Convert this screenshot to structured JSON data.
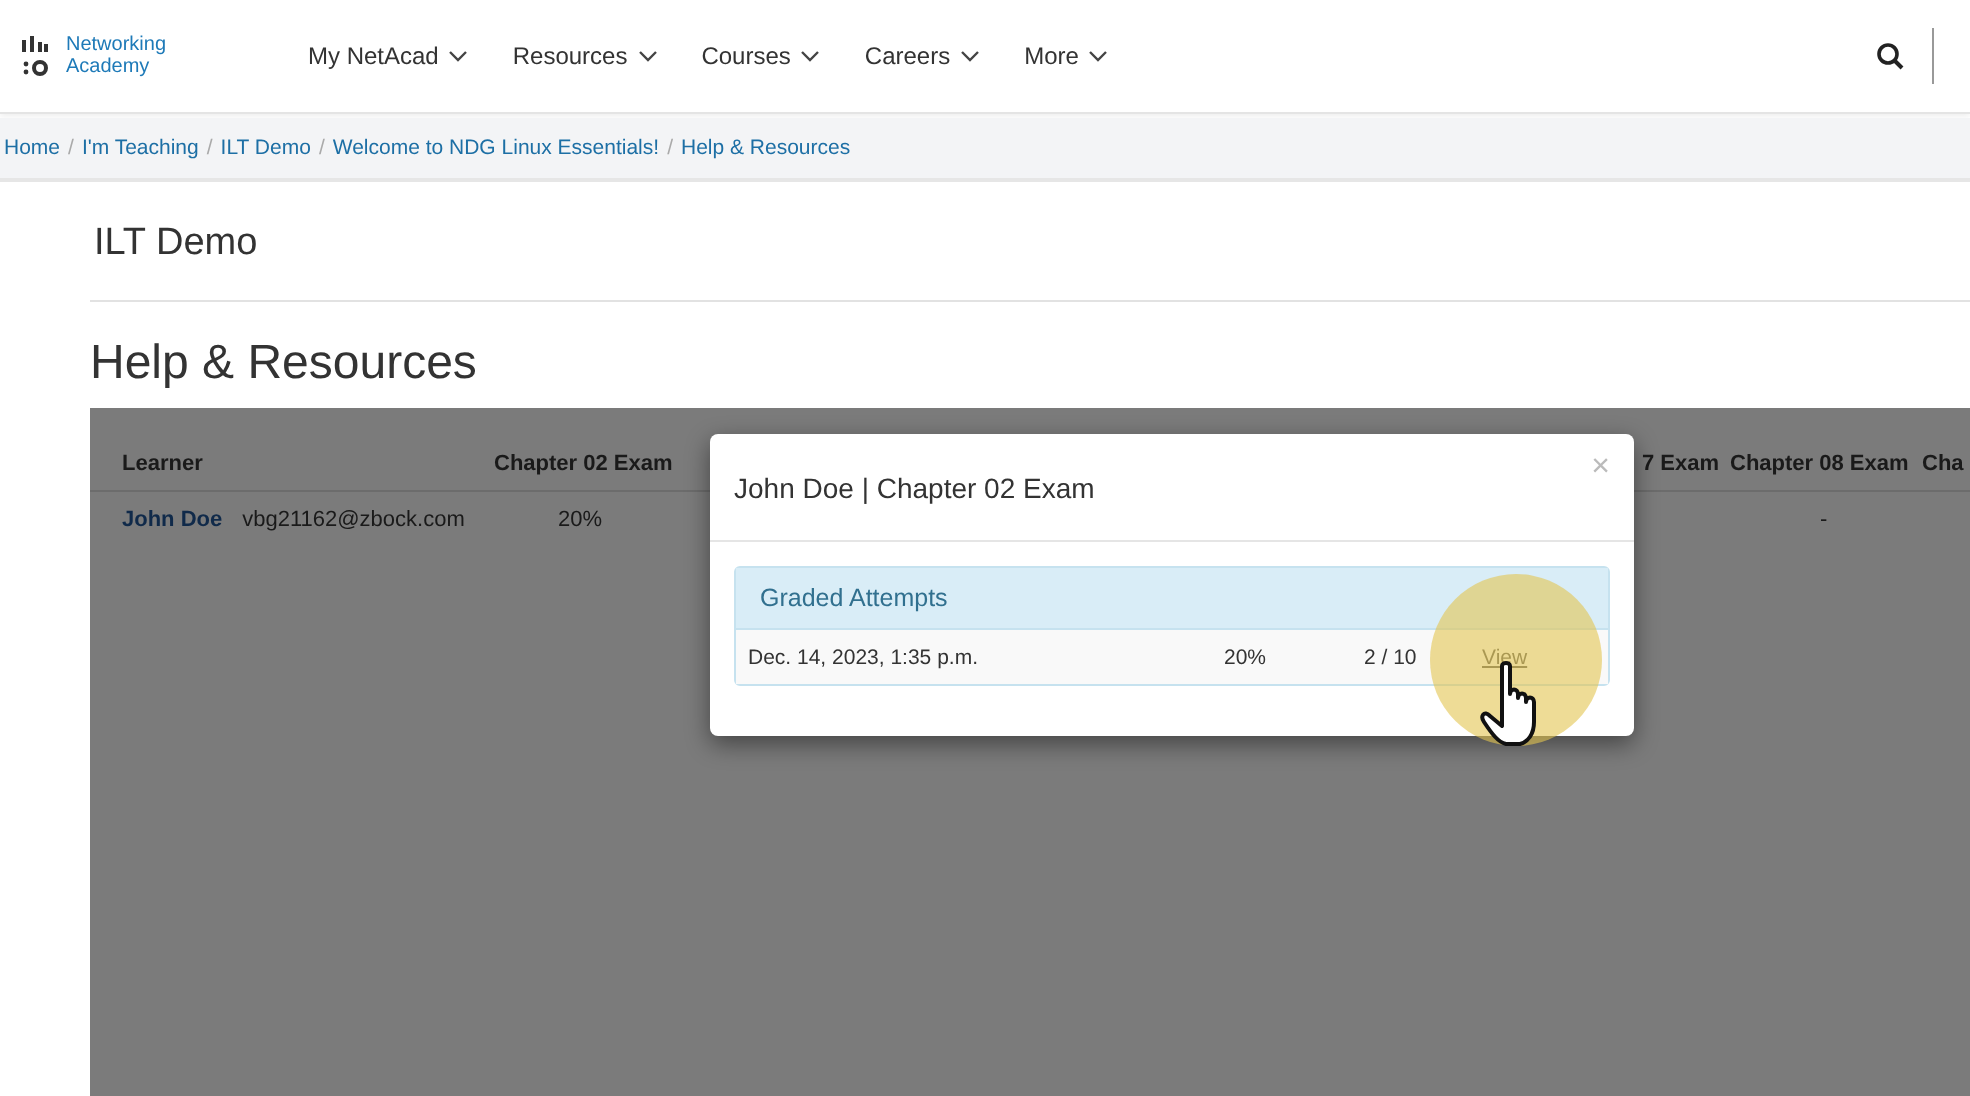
{
  "header": {
    "logo_text": [
      "Networking",
      "Academy"
    ],
    "menu": [
      {
        "label": "My NetAcad"
      },
      {
        "label": "Resources"
      },
      {
        "label": "Courses"
      },
      {
        "label": "Careers"
      },
      {
        "label": "More"
      }
    ]
  },
  "breadcrumb_separator": "/",
  "breadcrumb": [
    "Home",
    "I'm Teaching",
    "ILT Demo",
    "Welcome to NDG Linux Essentials!",
    "Help & Resources"
  ],
  "class_title": "ILT Demo",
  "page_title": "Help & Resources",
  "table": {
    "columns": [
      "Learner",
      "Chapter 02 Exam",
      "7 Exam",
      "Chapter 08 Exam",
      "Cha"
    ],
    "rows": [
      {
        "learner": "John Doe",
        "email": "vbg21162@zbock.com",
        "chapter_02_exam": "20%",
        "chapter_08_exam": "-"
      }
    ]
  },
  "modal": {
    "title": "John Doe | Chapter 02 Exam",
    "close": "×",
    "panel_title": "Graded Attempts",
    "attempts": [
      {
        "date": "Dec. 14, 2023, 1:35 p.m.",
        "score": "20%",
        "points": "2 / 10",
        "action": "View"
      }
    ]
  }
}
